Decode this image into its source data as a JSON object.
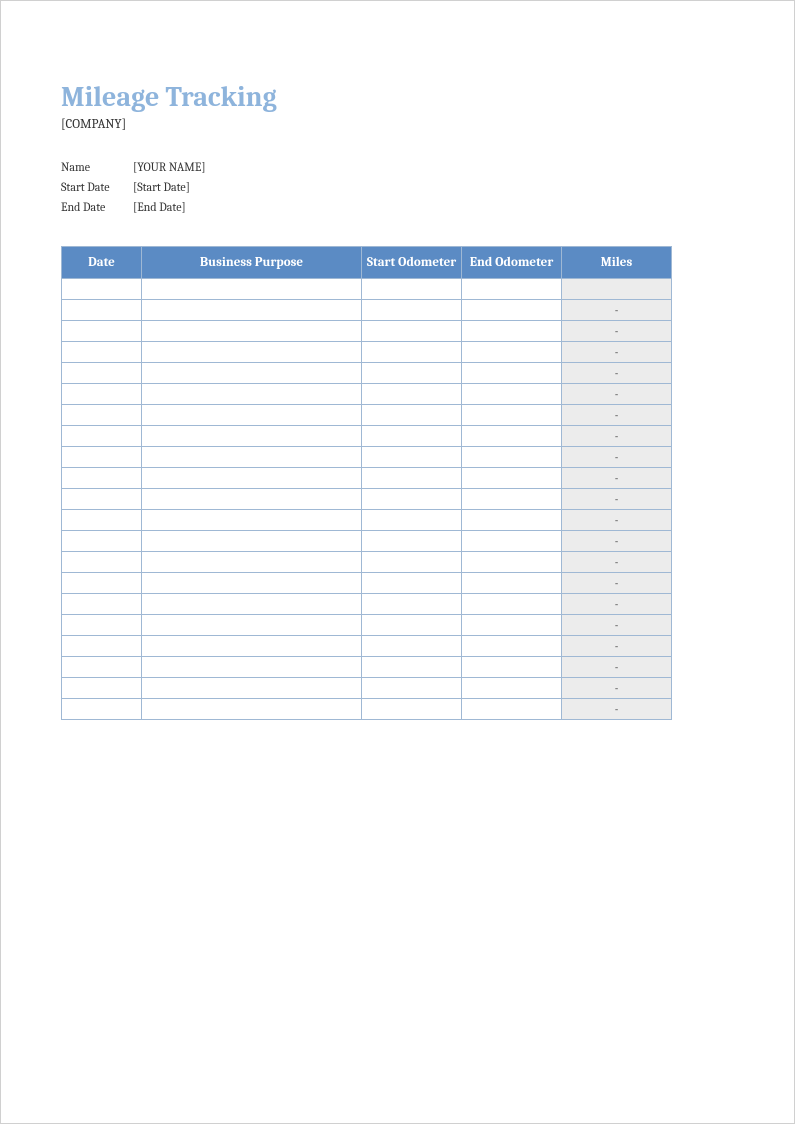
{
  "header": {
    "title": "Mileage Tracking",
    "company": "[COMPANY]"
  },
  "info": {
    "name_label": "Name",
    "name_value": "[YOUR NAME]",
    "start_date_label": "Start Date",
    "start_date_value": "[Start Date]",
    "end_date_label": "End Date",
    "end_date_value": "[End Date]"
  },
  "table": {
    "columns": {
      "date": "Date",
      "purpose": "Business Purpose",
      "start_odo": "Start Odometer",
      "end_odo": "End Odometer",
      "miles": "Miles"
    },
    "rows": [
      {
        "date": "",
        "purpose": "",
        "start_odo": "",
        "end_odo": "",
        "miles": ""
      },
      {
        "date": "",
        "purpose": "",
        "start_odo": "",
        "end_odo": "",
        "miles": "-"
      },
      {
        "date": "",
        "purpose": "",
        "start_odo": "",
        "end_odo": "",
        "miles": "-"
      },
      {
        "date": "",
        "purpose": "",
        "start_odo": "",
        "end_odo": "",
        "miles": "-"
      },
      {
        "date": "",
        "purpose": "",
        "start_odo": "",
        "end_odo": "",
        "miles": "-"
      },
      {
        "date": "",
        "purpose": "",
        "start_odo": "",
        "end_odo": "",
        "miles": "-"
      },
      {
        "date": "",
        "purpose": "",
        "start_odo": "",
        "end_odo": "",
        "miles": "-"
      },
      {
        "date": "",
        "purpose": "",
        "start_odo": "",
        "end_odo": "",
        "miles": "-"
      },
      {
        "date": "",
        "purpose": "",
        "start_odo": "",
        "end_odo": "",
        "miles": "-"
      },
      {
        "date": "",
        "purpose": "",
        "start_odo": "",
        "end_odo": "",
        "miles": "-"
      },
      {
        "date": "",
        "purpose": "",
        "start_odo": "",
        "end_odo": "",
        "miles": "-"
      },
      {
        "date": "",
        "purpose": "",
        "start_odo": "",
        "end_odo": "",
        "miles": "-"
      },
      {
        "date": "",
        "purpose": "",
        "start_odo": "",
        "end_odo": "",
        "miles": "-"
      },
      {
        "date": "",
        "purpose": "",
        "start_odo": "",
        "end_odo": "",
        "miles": "-"
      },
      {
        "date": "",
        "purpose": "",
        "start_odo": "",
        "end_odo": "",
        "miles": "-"
      },
      {
        "date": "",
        "purpose": "",
        "start_odo": "",
        "end_odo": "",
        "miles": "-"
      },
      {
        "date": "",
        "purpose": "",
        "start_odo": "",
        "end_odo": "",
        "miles": "-"
      },
      {
        "date": "",
        "purpose": "",
        "start_odo": "",
        "end_odo": "",
        "miles": "-"
      },
      {
        "date": "",
        "purpose": "",
        "start_odo": "",
        "end_odo": "",
        "miles": "-"
      },
      {
        "date": "",
        "purpose": "",
        "start_odo": "",
        "end_odo": "",
        "miles": "-"
      },
      {
        "date": "",
        "purpose": "",
        "start_odo": "",
        "end_odo": "",
        "miles": "-"
      }
    ]
  }
}
